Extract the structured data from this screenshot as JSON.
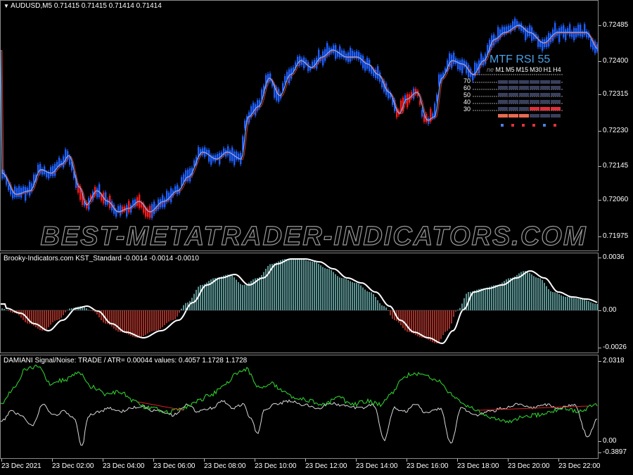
{
  "main": {
    "symbol_marker": "▼",
    "header": "AUDUSD,M5  0.71415 0.71415 0.71414 0.71414",
    "price_ticks": [
      "0.72485",
      "0.72400",
      "0.72315",
      "0.72230",
      "0.72145",
      "0.72060",
      "0.71975"
    ],
    "watermark": "BEST-METATRADER-INDICATORS.COM"
  },
  "mtf_rsi": {
    "title": "MTF RSI  55",
    "prefix": "ne",
    "timeframes": [
      "M1",
      "M5",
      "M15",
      "M30",
      "H1",
      "H4"
    ],
    "levels": [
      "70",
      "60",
      "50",
      "40",
      "30"
    ]
  },
  "kst": {
    "header": "Brooky-Indicators.com KST_Standard -0.0014 -0.0014 -0.0010",
    "ticks": [
      "0.0036",
      "0.00",
      "-0.0026"
    ]
  },
  "damiani": {
    "header": "DAMIANI Signal/Noise: TRADE  /  ATR= 0.00044     values: 0.4057 1.1728 1.1728",
    "ticks": [
      "2.0318",
      "0.00",
      "-0.3897"
    ]
  },
  "time_axis": [
    "23 Dec 2021",
    "23 Dec 02:00",
    "23 Dec 04:00",
    "23 Dec 06:00",
    "23 Dec 08:00",
    "23 Dec 10:00",
    "23 Dec 12:00",
    "23 Dec 14:00",
    "23 Dec 16:00",
    "23 Dec 18:00",
    "23 Dec 20:00",
    "23 Dec 22:00"
  ],
  "colors": {
    "bull_candle": "#1e5fff",
    "bear_candle": "#ff1a1a",
    "ma_fast": "#7fb0ff",
    "ma_slow": "#c0392b",
    "kst_pos": "#7fd1cf",
    "kst_neg": "#e0443a",
    "kst_line": "#ffffff",
    "dam_green": "#2ecc2e",
    "dam_white": "#d9d9d9",
    "dam_red": "#e02020",
    "grid": "#8a8a8a"
  }
}
